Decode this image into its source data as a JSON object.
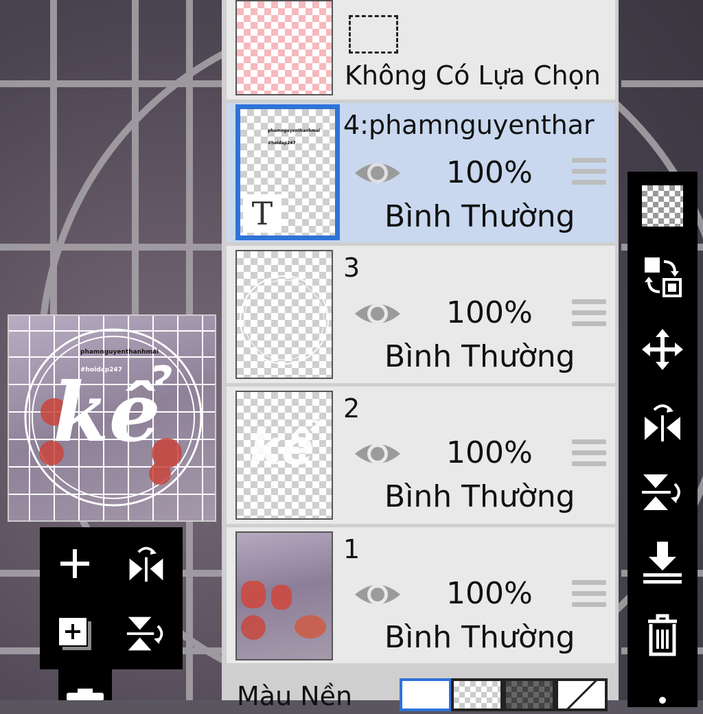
{
  "top_layer": {
    "selection_text": "Không Có Lựa Chọn"
  },
  "layers": [
    {
      "name": "4:phamnguyenthar",
      "opacity": "100%",
      "blend": "Bình Thường",
      "thumb_icon": "T"
    },
    {
      "name": "3",
      "opacity": "100%",
      "blend": "Bình Thường"
    },
    {
      "name": "2",
      "opacity": "100%",
      "blend": "Bình Thường"
    },
    {
      "name": "1",
      "opacity": "100%",
      "blend": "Bình Thường"
    }
  ],
  "background_color_label": "Màu Nền",
  "preview": {
    "watermark_1": "phamnguyenthanhmai",
    "watermark_2": "#hoidap247",
    "main_text": "kể"
  },
  "thumb4": {
    "line1": "phamnguyenthanhmai",
    "line2": "#hoidap247"
  },
  "right_toolbar": [
    "checker-icon",
    "swap-layer-icon",
    "move-icon",
    "flip-horizontal-icon",
    "flip-vertical-icon",
    "merge-down-icon",
    "delete-icon",
    "more-icon"
  ],
  "left_toolbar": [
    "add-layer-icon",
    "flip-horizontal-icon",
    "duplicate-layer-icon",
    "flip-vertical-icon",
    "camera-icon"
  ],
  "colors": {
    "accent": "#2f73d8",
    "selected_row": "#c9d8ee",
    "row": "#e9e9e9"
  }
}
